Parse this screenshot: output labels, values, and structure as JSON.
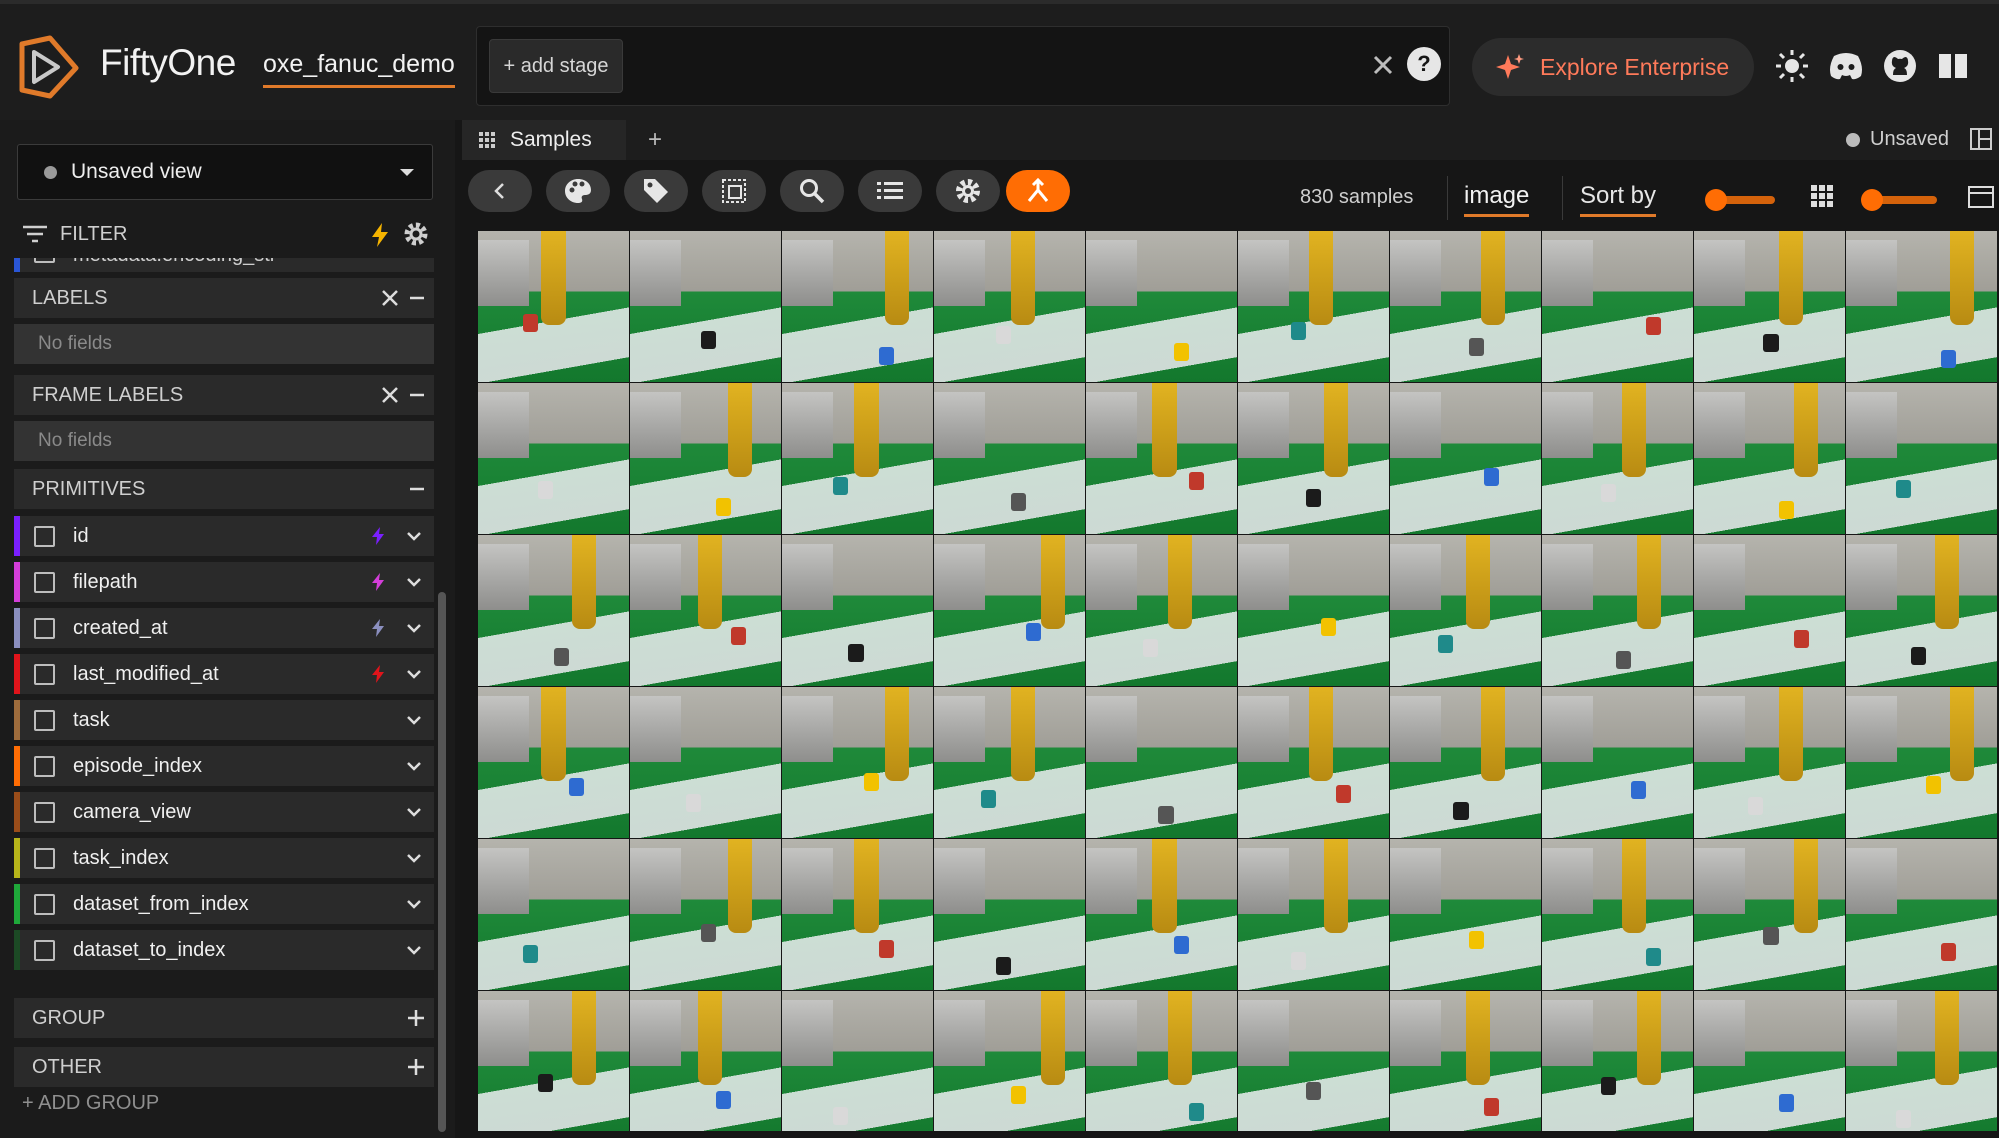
{
  "header": {
    "brand": "FiftyOne",
    "dataset": "oxe_fanuc_demo",
    "add_stage": "+ add stage",
    "explore": "Explore Enterprise",
    "icons": [
      "close-icon",
      "help-icon",
      "sun-icon",
      "discord-icon",
      "github-icon",
      "book-icon"
    ]
  },
  "sidebar": {
    "view": "Unsaved view",
    "filter": "FILTER",
    "partial_field": "metadata.encoding_str",
    "groups": {
      "labels": "LABELS",
      "frame_labels": "FRAME LABELS",
      "primitives": "PRIMITIVES",
      "group": "GROUP",
      "other": "OTHER"
    },
    "no_fields": "No fields",
    "fields": [
      {
        "name": "id",
        "color": "#7a1fff",
        "bolt": true
      },
      {
        "name": "filepath",
        "color": "#d43ed9",
        "bolt": true
      },
      {
        "name": "created_at",
        "color": "#8b8fbf",
        "bolt": true
      },
      {
        "name": "last_modified_at",
        "color": "#e0141b",
        "bolt": true
      },
      {
        "name": "task",
        "color": "#9e6c3c",
        "bolt": false
      },
      {
        "name": "episode_index",
        "color": "#ff6d04",
        "bolt": false
      },
      {
        "name": "camera_view",
        "color": "#9a4d1a",
        "bolt": false
      },
      {
        "name": "task_index",
        "color": "#b7b51a",
        "bolt": false
      },
      {
        "name": "dataset_from_index",
        "color": "#1fa83a",
        "bolt": false
      },
      {
        "name": "dataset_to_index",
        "color": "#1c4a25",
        "bolt": false
      }
    ],
    "add_group": "+ ADD GROUP"
  },
  "main": {
    "tab": "Samples",
    "unsaved": "Unsaved",
    "count": "830 samples",
    "field": "image",
    "sort": "Sort by"
  },
  "colors": {
    "accent": "#ff6d04",
    "background": "#161616"
  }
}
